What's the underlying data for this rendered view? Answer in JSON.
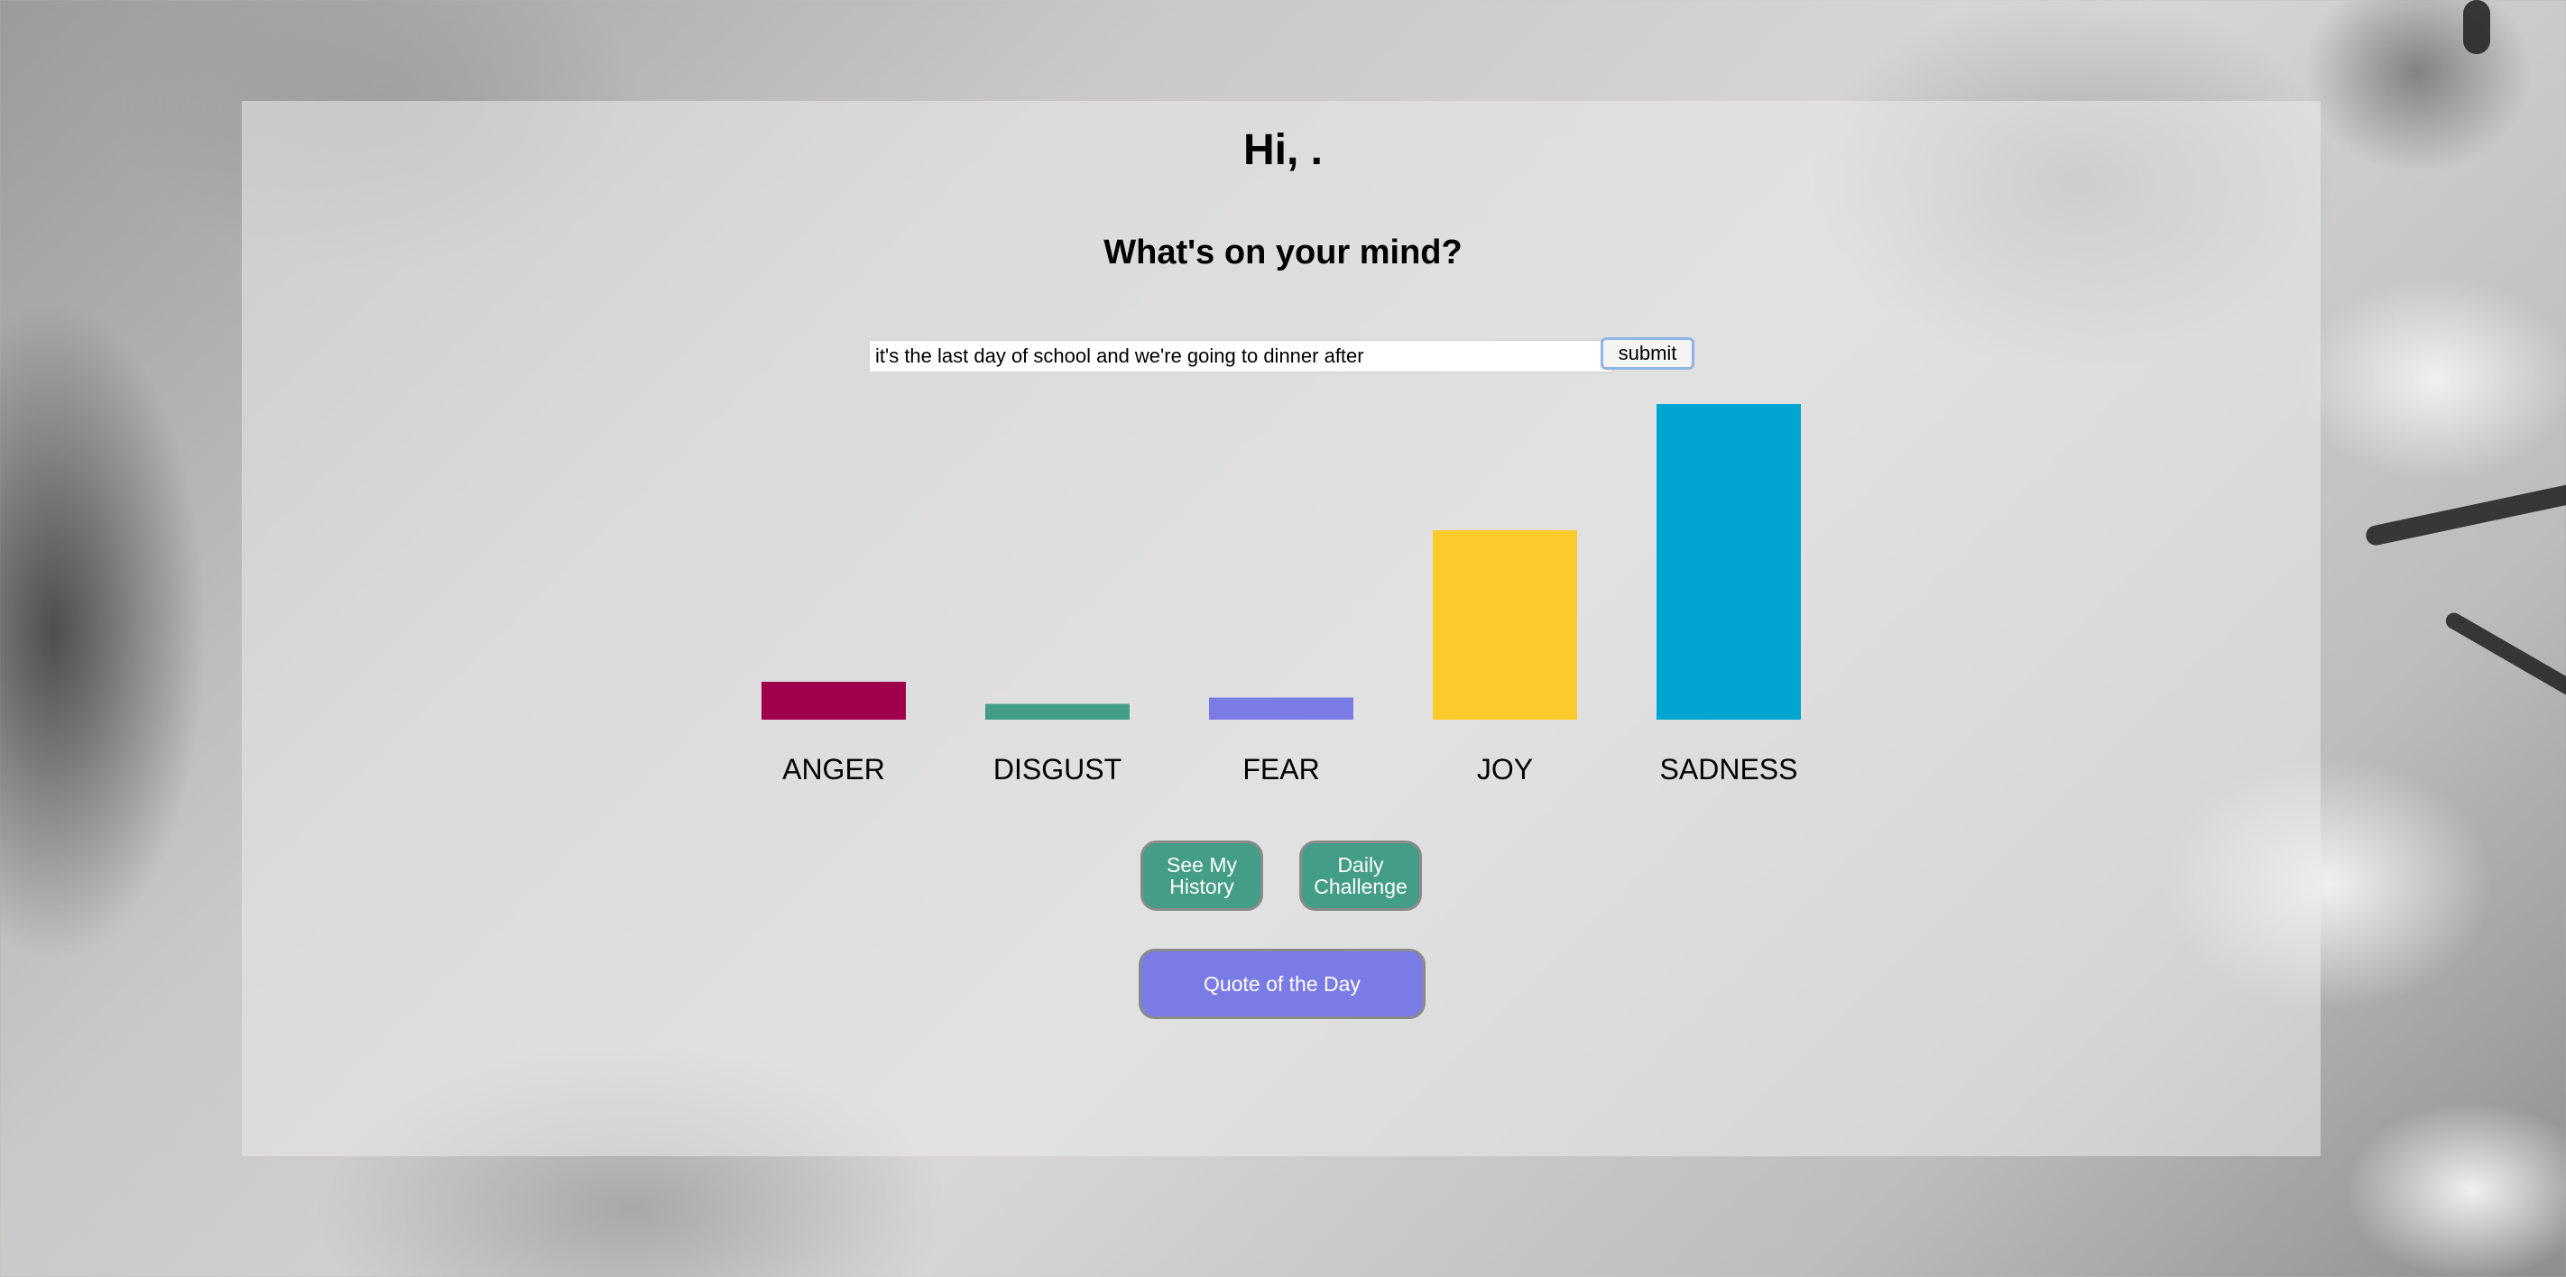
{
  "greeting": "Hi, .",
  "prompt": "What's on your mind?",
  "entry": {
    "value": "it's the last day of school and we're going to dinner after",
    "submit_label": "submit"
  },
  "chart_data": {
    "type": "bar",
    "categories": [
      "ANGER",
      "DISGUST",
      "FEAR",
      "JOY",
      "SADNESS"
    ],
    "values": [
      0.12,
      0.05,
      0.07,
      0.6,
      1.0
    ],
    "colors": [
      "#a0004b",
      "#439d87",
      "#7b7be6",
      "#fdca2b",
      "#00a5d0"
    ],
    "ylim": [
      0,
      1
    ],
    "grid": false
  },
  "buttons": {
    "history": "See My History",
    "challenge": "Daily Challenge",
    "quote": "Quote of the Day"
  },
  "colors": {
    "teal_button": "#439d87",
    "purple_button": "#7b7be6"
  }
}
